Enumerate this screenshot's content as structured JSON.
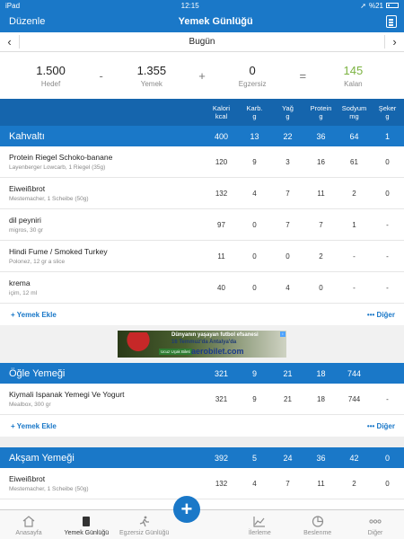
{
  "status": {
    "device": "iPad",
    "time": "12:15",
    "battery": "%21"
  },
  "nav": {
    "edit": "Düzenle",
    "title": "Yemek Günlüğü"
  },
  "date": {
    "label": "Bugün",
    "prev": "‹",
    "next": "›"
  },
  "summary": {
    "goal": {
      "value": "1.500",
      "label": "Hedef"
    },
    "op1": "-",
    "food": {
      "value": "1.355",
      "label": "Yemek"
    },
    "op2": "+",
    "exercise": {
      "value": "0",
      "label": "Egzersiz"
    },
    "op3": "=",
    "remaining": {
      "value": "145",
      "label": "Kalan"
    }
  },
  "columns": [
    {
      "name": "Kalori",
      "unit": "kcal"
    },
    {
      "name": "Karb.",
      "unit": "g"
    },
    {
      "name": "Yağ",
      "unit": "g"
    },
    {
      "name": "Protein",
      "unit": "g"
    },
    {
      "name": "Sodyum",
      "unit": "mg"
    },
    {
      "name": "Şeker",
      "unit": "g"
    }
  ],
  "meals": [
    {
      "name": "Kahvaltı",
      "totals": [
        "400",
        "13",
        "22",
        "36",
        "64",
        "1"
      ],
      "items": [
        {
          "name": "Protein Riegel Schoko-banane",
          "sub": "Layenberger Lowcarb, 1 Riegel (35g)",
          "values": [
            "120",
            "9",
            "3",
            "16",
            "61",
            "0"
          ]
        },
        {
          "name": "Eiweißbrot",
          "sub": "Mestemacher, 1 Scheibe (50g)",
          "values": [
            "132",
            "4",
            "7",
            "11",
            "2",
            "0"
          ]
        },
        {
          "name": "dil peyniri",
          "sub": "migros, 30 gr",
          "values": [
            "97",
            "0",
            "7",
            "7",
            "1",
            "-"
          ]
        },
        {
          "name": "Hindi Fume / Smoked Turkey",
          "sub": "Polonez, 12 gr a slice",
          "values": [
            "11",
            "0",
            "0",
            "2",
            "-",
            "-"
          ]
        },
        {
          "name": "krema",
          "sub": "içim, 12 ml",
          "values": [
            "40",
            "0",
            "4",
            "0",
            "-",
            "-"
          ]
        }
      ]
    },
    {
      "name": "Öğle Yemeği",
      "totals": [
        "321",
        "9",
        "21",
        "18",
        "744",
        ""
      ],
      "items": [
        {
          "name": "Kiymali Ispanak Yemegi Ve Yogurt",
          "sub": "Mealbox, 300 gr",
          "values": [
            "321",
            "9",
            "21",
            "18",
            "744",
            "-"
          ]
        }
      ]
    },
    {
      "name": "Akşam Yemeği",
      "totals": [
        "392",
        "5",
        "24",
        "36",
        "42",
        "0"
      ],
      "items": [
        {
          "name": "Eiweißbrot",
          "sub": "Mestemacher, 1 Scheibe (50g)",
          "values": [
            "132",
            "4",
            "7",
            "11",
            "2",
            "0"
          ]
        }
      ]
    }
  ],
  "actions": {
    "add": "+ Yemek Ekle",
    "more": "••• Diğer"
  },
  "ad": {
    "line1": "Dünyanın yaşayan futbol efsanesi",
    "line2": "16 Temmuz'da Antalya'da",
    "brand": "aerobilet.com",
    "tag": "Ucuz Uçak Bileti"
  },
  "tabs": [
    {
      "label": "Anasayfa",
      "icon": "home-icon"
    },
    {
      "label": "Yemek Günlüğü",
      "icon": "diary-icon"
    },
    {
      "label": "Egzersiz Günlüğü",
      "icon": "runner-icon"
    },
    {
      "label": "+",
      "icon": "plus-icon"
    },
    {
      "label": "İlerleme",
      "icon": "progress-icon"
    },
    {
      "label": "Beslenme",
      "icon": "pie-chart-icon"
    },
    {
      "label": "Diğer",
      "icon": "more-icon"
    }
  ],
  "colors": {
    "primary": "#1a78c8",
    "header": "#1565ad",
    "remaining": "#7cb342"
  }
}
